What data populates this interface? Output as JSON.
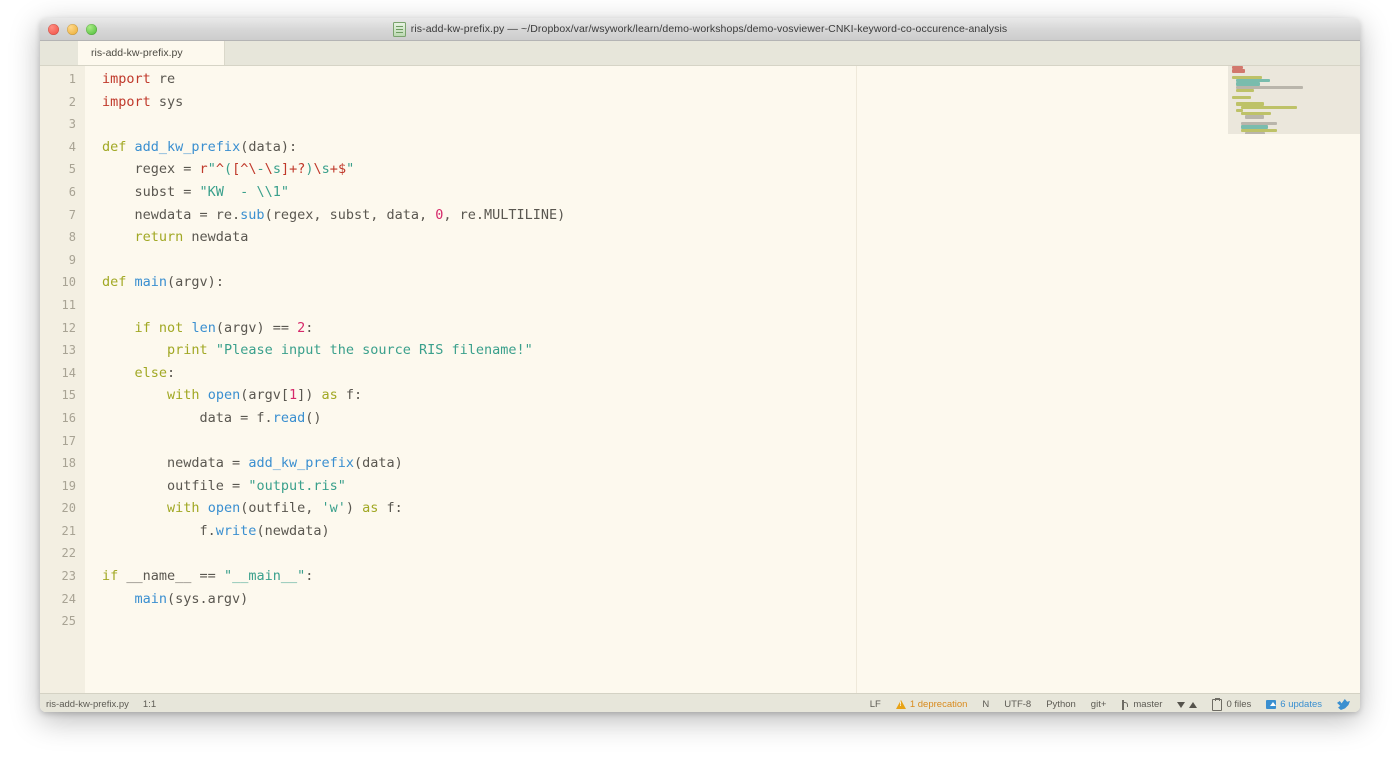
{
  "window": {
    "title": "ris-add-kw-prefix.py — ~/Dropbox/var/wsywork/learn/demo-workshops/demo-vosviewer-CNKI-keyword-co-occurence-analysis",
    "traffic_lights": [
      "close",
      "minimize",
      "zoom"
    ]
  },
  "tabs": [
    {
      "label": "ris-add-kw-prefix.py",
      "active": true
    }
  ],
  "editor": {
    "language": "Python",
    "line_numbers": [
      "1",
      "2",
      "3",
      "4",
      "5",
      "6",
      "7",
      "8",
      "9",
      "10",
      "11",
      "12",
      "13",
      "14",
      "15",
      "16",
      "17",
      "18",
      "19",
      "20",
      "21",
      "22",
      "23",
      "24",
      "25"
    ],
    "lines": [
      "import re",
      "import sys",
      "",
      "def add_kw_prefix(data):",
      "    regex = r\"^([^\\-\\s]+?)\\s+$\"",
      "    subst = \"KW  - \\\\1\"",
      "    newdata = re.sub(regex, subst, data, 0, re.MULTILINE)",
      "    return newdata",
      "",
      "def main(argv):",
      "",
      "    if not len(argv) == 2:",
      "        print \"Please input the source RIS filename!\"",
      "    else:",
      "        with open(argv[1]) as f:",
      "            data = f.read()",
      "",
      "        newdata = add_kw_prefix(data)",
      "        outfile = \"output.ris\"",
      "        with open(outfile, 'w') as f:",
      "            f.write(newdata)",
      "",
      "if __name__ == \"__main__\":",
      "    main(sys.argv)",
      ""
    ]
  },
  "statusbar": {
    "filename": "ris-add-kw-prefix.py",
    "cursor": "1:1",
    "line_ending": "LF",
    "deprecation": "1 deprecation",
    "n_marker": "N",
    "encoding": "UTF-8",
    "grammar": "Python",
    "git_plus": "git+",
    "branch": "master",
    "files": "0 files",
    "updates": "6 updates"
  },
  "colors": {
    "editor_bg": "#fdf9ee",
    "gutter_bg": "#f3efe2",
    "chrome_bg": "#e7e6da",
    "keyword": "#a1a824",
    "import": "#c0392b",
    "function": "#3a8fd0",
    "string": "#3aa08c",
    "number": "#d6296a",
    "plain": "#5a5750",
    "warning": "#d98b1e",
    "link": "#3a8fd0"
  }
}
